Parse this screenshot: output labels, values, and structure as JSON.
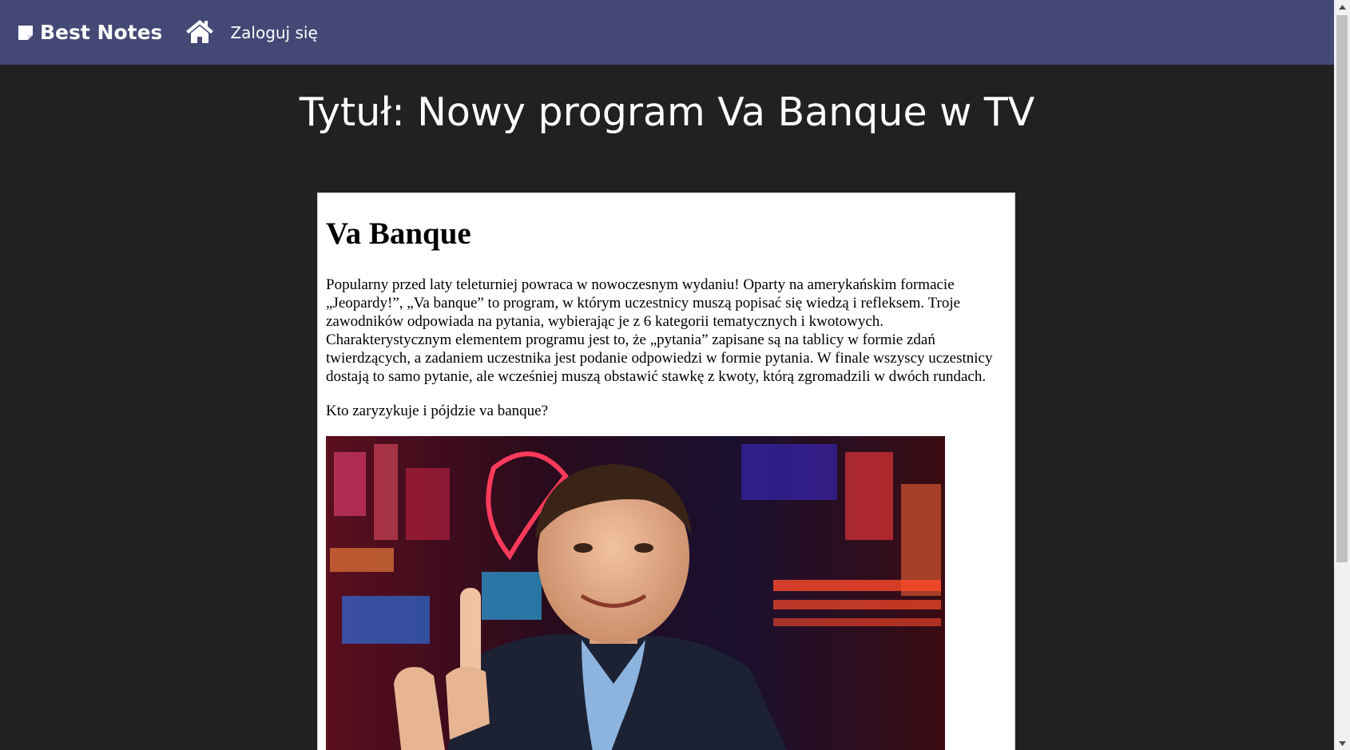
{
  "navbar": {
    "brand_label": "Best Notes",
    "brand_icon": "sticky-note-icon",
    "home_icon": "home-icon",
    "login_label": "Zaloguj się",
    "background_color": "#434875"
  },
  "main": {
    "title": "Tytuł: Nowy program Va Banque w TV"
  },
  "note": {
    "heading": "Va Banque",
    "paragraph": "Popularny przed laty teleturniej powraca w nowoczesnym wydaniu! Oparty na amerykańskim formacie „Jeopardy!”, „Va banque” to program, w którym uczestnicy muszą popisać się wiedzą i refleksem. Troje zawodników odpowiada na pytania, wybierając je z 6 kategorii tematycznych i kwotowych. Charakterystycznym elementem programu jest to, że „pytania” zapisane są na tablicy w formie zdań twierdzących, a zadaniem uczestnika jest podanie odpowiedzi w formie pytania. W finale wszyscy uczestnicy dostają to samo pytanie, ale wcześniej muszą obstawić stawkę z kwoty, którą zgromadzili w dwóch rundach.",
    "question": "Kto zaryzykuje i pójdzie va banque?",
    "image_description_icon": "tv-host-photo"
  },
  "colors": {
    "page_background": "#212121",
    "card_background": "#ffffff",
    "accent": "#434875"
  }
}
